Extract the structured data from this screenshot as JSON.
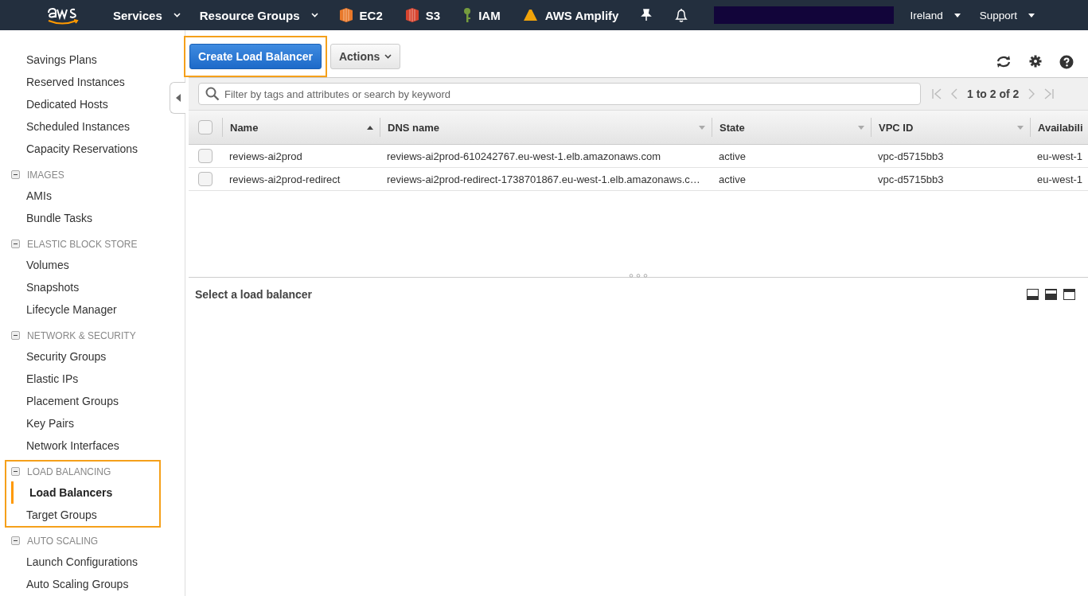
{
  "top_nav": {
    "menus": [
      {
        "label": "Services",
        "dropdown": true
      },
      {
        "label": "Resource Groups",
        "dropdown": true
      }
    ],
    "shortcuts": [
      {
        "label": "EC2",
        "kind": "ec2"
      },
      {
        "label": "S3",
        "kind": "s3"
      },
      {
        "label": "IAM",
        "kind": "iam"
      },
      {
        "label": "AWS Amplify",
        "kind": "amplify"
      }
    ],
    "right_menus": [
      {
        "label": "Ireland"
      },
      {
        "label": "Support"
      }
    ]
  },
  "sidebar": {
    "groups": [
      {
        "items": [
          {
            "label": "Savings Plans",
            "selected": false
          },
          {
            "label": "Reserved Instances",
            "selected": false
          },
          {
            "label": "Dedicated Hosts",
            "selected": false
          },
          {
            "label": "Scheduled Instances",
            "selected": false
          },
          {
            "label": "Capacity Reservations",
            "selected": false
          }
        ]
      },
      {
        "heading": "IMAGES",
        "expanded": true,
        "highlighted": false,
        "items": [
          {
            "label": "AMIs",
            "selected": false
          },
          {
            "label": "Bundle Tasks",
            "selected": false
          }
        ]
      },
      {
        "heading": "ELASTIC BLOCK STORE",
        "expanded": true,
        "highlighted": false,
        "items": [
          {
            "label": "Volumes",
            "selected": false
          },
          {
            "label": "Snapshots",
            "selected": false
          },
          {
            "label": "Lifecycle Manager",
            "selected": false
          }
        ]
      },
      {
        "heading": "NETWORK & SECURITY",
        "expanded": true,
        "highlighted": false,
        "items": [
          {
            "label": "Security Groups",
            "selected": false
          },
          {
            "label": "Elastic IPs",
            "selected": false
          },
          {
            "label": "Placement Groups",
            "selected": false
          },
          {
            "label": "Key Pairs",
            "selected": false
          },
          {
            "label": "Network Interfaces",
            "selected": false
          }
        ]
      },
      {
        "heading": "LOAD BALANCING",
        "expanded": true,
        "highlighted": true,
        "items": [
          {
            "label": "Load Balancers",
            "selected": true
          },
          {
            "label": "Target Groups",
            "selected": false
          }
        ]
      },
      {
        "heading": "AUTO SCALING",
        "expanded": true,
        "highlighted": false,
        "items": [
          {
            "label": "Launch Configurations",
            "selected": false
          },
          {
            "label": "Auto Scaling Groups",
            "selected": false
          }
        ]
      }
    ]
  },
  "toolbar": {
    "create_button": {
      "label": "Create Load Balancer",
      "highlighted": true
    },
    "actions_button": {
      "label": "Actions"
    }
  },
  "filter": {
    "placeholder": "Filter by tags and attributes or search by keyword"
  },
  "pagination": {
    "label": "1 to 2 of 2"
  },
  "table": {
    "select_all": {
      "checked": false
    },
    "columns": [
      {
        "label": "Name",
        "sorted": true
      },
      {
        "label": "DNS name",
        "sorted": false
      },
      {
        "label": "State",
        "sorted": false
      },
      {
        "label": "VPC ID",
        "sorted": false
      },
      {
        "label": "Availabili"
      }
    ],
    "rows": [
      {
        "selected": false,
        "cells": [
          "reviews-ai2prod",
          "reviews-ai2prod-610242767.eu-west-1.elb.amazonaws.com",
          "active",
          "vpc-d5715bb3",
          "eu-west-1"
        ]
      },
      {
        "selected": false,
        "cells": [
          "reviews-ai2prod-redirect",
          "reviews-ai2prod-redirect-1738701867.eu-west-1.elb.amazonaws.c…",
          "active",
          "vpc-d5715bb3",
          "eu-west-1"
        ]
      }
    ]
  },
  "details": {
    "title": "Select a load balancer"
  }
}
